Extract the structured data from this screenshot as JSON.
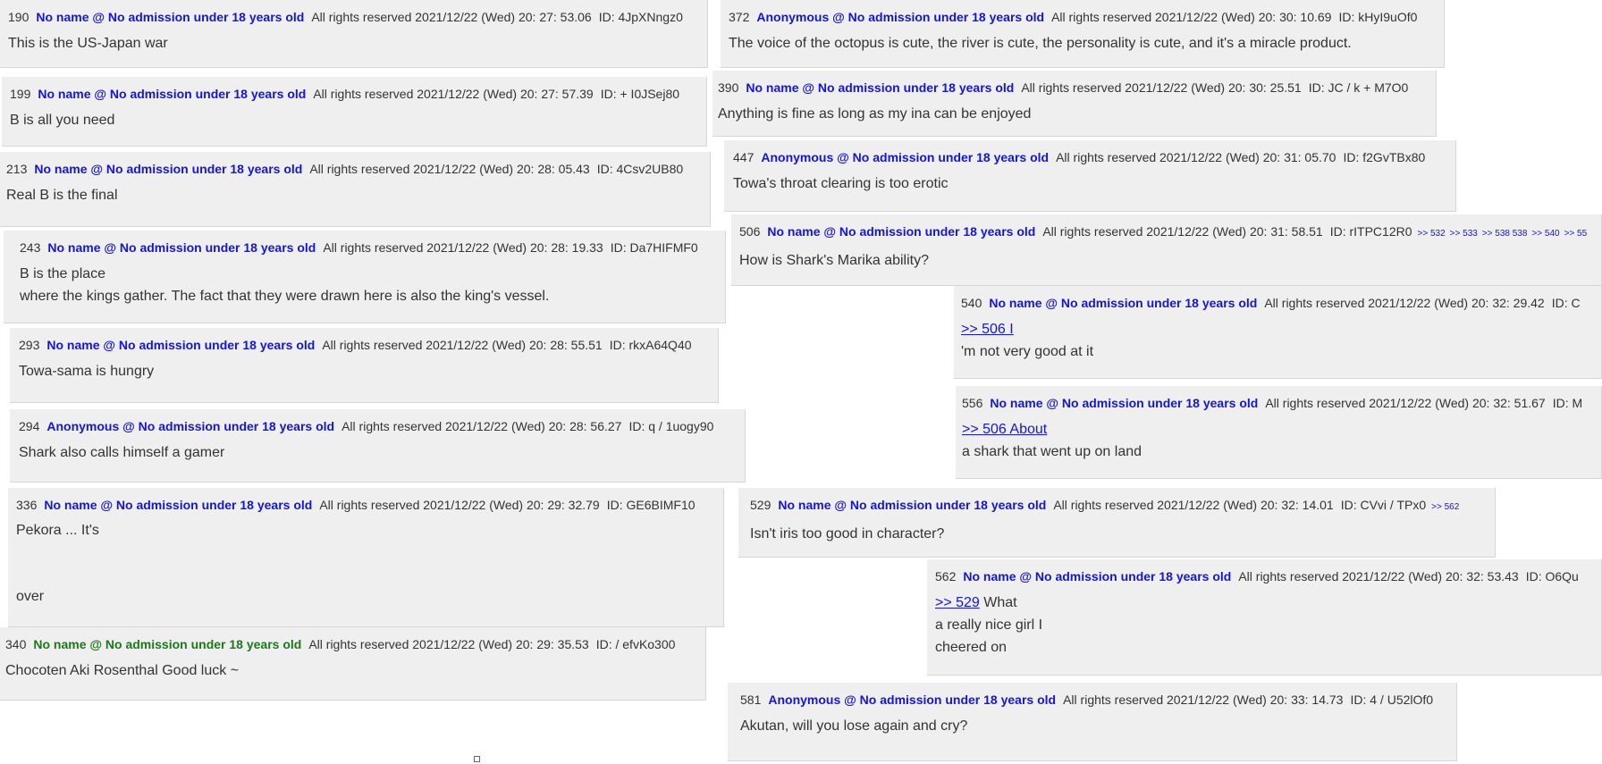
{
  "posts": [
    {
      "num": "190",
      "name": "No name @ No admission under 18 years old",
      "date": "All rights reserved 2021/12/22 (Wed) 20: 27: 53.06",
      "id": "ID: 4JpXNngz0",
      "lines": [
        "This is the US-Japan war"
      ]
    },
    {
      "num": "199",
      "name": "No name @ No admission under 18 years old",
      "date": "All rights reserved 2021/12/22 (Wed) 20: 27: 57.39",
      "id": "ID: + I0JSej80",
      "lines": [
        "B is all you need"
      ]
    },
    {
      "num": "213",
      "name": "No name @ No admission under 18 years old",
      "date": "All rights reserved 2021/12/22 (Wed) 20: 28: 05.43",
      "id": "ID: 4Csv2UB80",
      "lines": [
        "Real B is the final"
      ]
    },
    {
      "num": "243",
      "name": "No name @ No admission under 18 years old",
      "date": "All rights reserved 2021/12/22 (Wed) 20: 28: 19.33",
      "id": "ID: Da7HIFMF0",
      "lines": [
        "B is the place",
        "where the kings gather. The fact that they were drawn here is also the king's vessel."
      ]
    },
    {
      "num": "293",
      "name": "No name @ No admission under 18 years old",
      "date": "All rights reserved 2021/12/22 (Wed) 20: 28: 55.51",
      "id": "ID: rkxA64Q40",
      "lines": [
        "Towa-sama is hungry"
      ]
    },
    {
      "num": "294",
      "name": "Anonymous @ No admission under 18 years old",
      "date": "All rights reserved 2021/12/22 (Wed) 20: 28: 56.27",
      "id": "ID: q / 1uogy90",
      "lines": [
        "Shark also calls himself a gamer"
      ]
    },
    {
      "num": "336",
      "name": "No name @ No admission under 18 years old",
      "date": "All rights reserved 2021/12/22 (Wed) 20: 29: 32.79",
      "id": "ID: GE6BIMF10",
      "lines": [
        "Pekora ... It's",
        "",
        "",
        "over"
      ]
    },
    {
      "num": "340",
      "name": "No name @ No admission under 18 years old",
      "date": "All rights reserved 2021/12/22 (Wed) 20: 29: 35.53",
      "id": "ID: / efvKo300",
      "lines": [
        "Chocoten Aki Rosenthal Good luck ~"
      ]
    },
    {
      "num": "372",
      "name": "Anonymous @ No admission under 18 years old",
      "date": "All rights reserved 2021/12/22 (Wed) 20: 30: 10.69",
      "id": "ID: kHyI9uOf0",
      "lines": [
        "The voice of the octopus is cute, the river is cute, the personality is cute, and it's a miracle product."
      ]
    },
    {
      "num": "390",
      "name": "No name @ No admission under 18 years old",
      "date": "All rights reserved 2021/12/22 (Wed) 20: 30: 25.51",
      "id": "ID: JC / k + M7O0",
      "lines": [
        "Anything is fine as long as my ina can be enjoyed"
      ]
    },
    {
      "num": "447",
      "name": "Anonymous @ No admission under 18 years old",
      "date": "All rights reserved 2021/12/22 (Wed) 20: 31: 05.70",
      "id": "ID: f2GvTBx80",
      "lines": [
        "Towa's throat clearing is too erotic"
      ]
    },
    {
      "num": "506",
      "name": "No name @ No admission under 18 years old",
      "date": "All rights reserved 2021/12/22 (Wed) 20: 31: 58.51",
      "id": "ID: rITPC12R0",
      "refs": [
        ">> 532",
        ">> 533",
        ">> 538 538",
        ">> 540",
        ">> 55"
      ],
      "lines": [
        "How is Shark's Marika ability?"
      ]
    },
    {
      "num": "540",
      "name": "No name @ No admission under 18 years old",
      "date": "All rights reserved 2021/12/22 (Wed) 20: 32: 29.42",
      "id": "ID: C",
      "reply": ">> 506 I",
      "lines": [
        "'m not very good at it"
      ]
    },
    {
      "num": "556",
      "name": "No name @ No admission under 18 years old",
      "date": "All rights reserved 2021/12/22 (Wed) 20: 32: 51.67",
      "id": "ID: M",
      "reply": ">> 506 About",
      "lines": [
        "a shark that went up on land"
      ]
    },
    {
      "num": "529",
      "name": "No name @ No admission under 18 years old",
      "date": "All rights reserved 2021/12/22 (Wed) 20: 32: 14.01",
      "id": "ID: CVvi / TPx0",
      "refs": [
        ">> 562"
      ],
      "lines": [
        "Isn't iris too good in character?"
      ]
    },
    {
      "num": "562",
      "name": "No name @ No admission under 18 years old",
      "date": "All rights reserved 2021/12/22 (Wed) 20: 32: 53.43",
      "id": "ID: O6Qu",
      "reply": ">> 529",
      "replyText": " What",
      "lines": [
        "a really nice girl I",
        "cheered on"
      ]
    },
    {
      "num": "581",
      "name": "Anonymous @ No admission under 18 years old",
      "date": "All rights reserved 2021/12/22 (Wed) 20: 33: 14.73",
      "id": "ID: 4 / U52lOf0",
      "lines": [
        "Akutan, will you lose again and cry?"
      ]
    }
  ],
  "colors": {
    "name": "#1515d5",
    "name_highlight": "#1a7a1a",
    "card_bg": "#efefef"
  }
}
